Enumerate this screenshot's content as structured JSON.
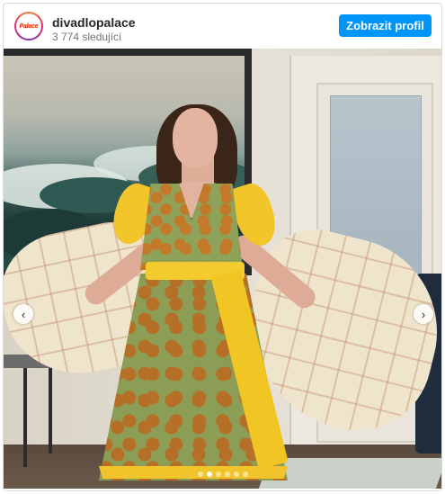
{
  "account": {
    "username": "divadlopalace",
    "followers": "3 774 sledující",
    "avatar_text": "Palace"
  },
  "header": {
    "profile_button_label": "Zobrazit profil"
  },
  "carousel": {
    "prev_icon": "chevron-left-icon",
    "next_icon": "chevron-right-icon",
    "prev_glyph": "‹",
    "next_glyph": "›",
    "slide_count": 6,
    "active_slide": 2
  },
  "colors": {
    "accent": "#0095f6",
    "text": "#262626",
    "muted": "#737373"
  }
}
